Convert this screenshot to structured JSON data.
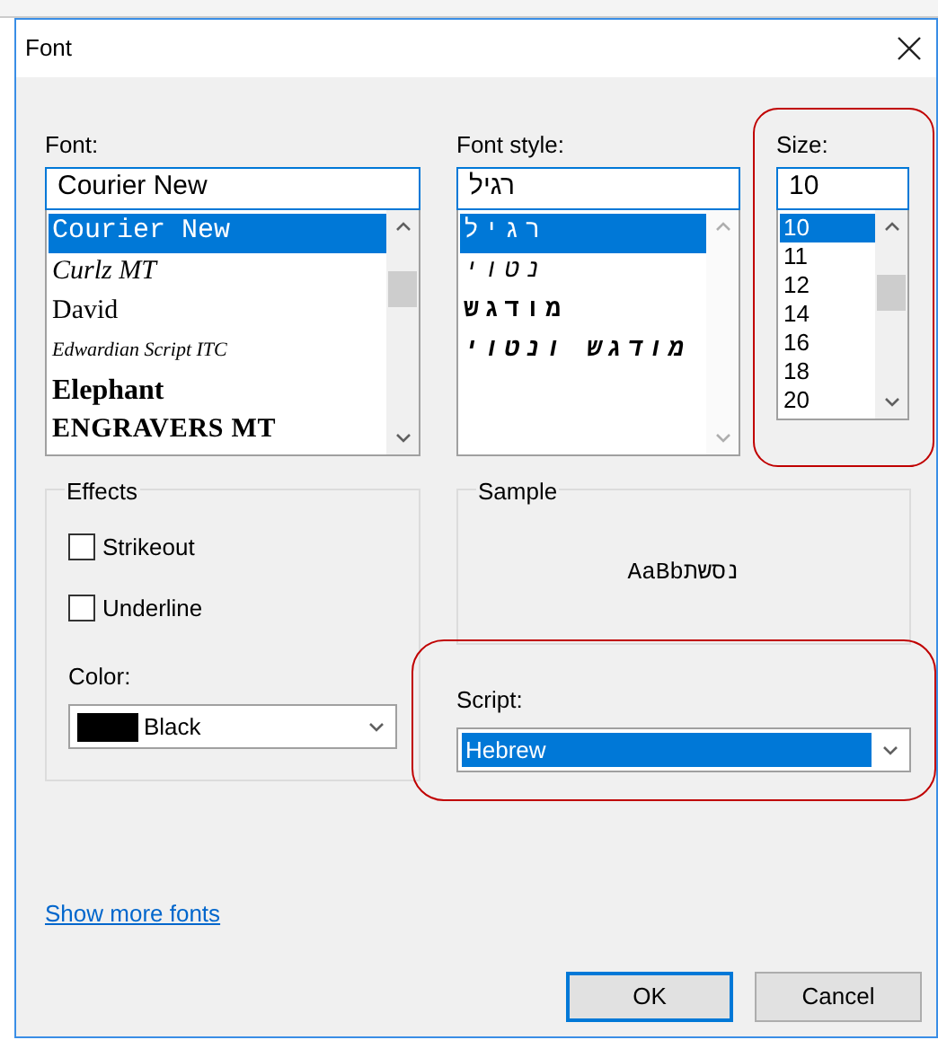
{
  "window": {
    "title": "Font"
  },
  "font": {
    "label": "Font:",
    "value": "Courier New",
    "items": [
      {
        "label": "Courier New",
        "selected": true
      },
      {
        "label": "Curlz MT",
        "selected": false
      },
      {
        "label": "David",
        "selected": false
      },
      {
        "label": "Edwardian Script ITC",
        "selected": false
      },
      {
        "label": "Elephant",
        "selected": false
      },
      {
        "label": "ENGRAVERS MT",
        "selected": false
      }
    ]
  },
  "font_style": {
    "label": "Font style:",
    "value": "רגיל",
    "items": [
      {
        "label": "רגיל",
        "selected": true
      },
      {
        "label": "נטוי",
        "selected": false
      },
      {
        "label": "מודגש",
        "selected": false
      },
      {
        "label": "מודגש ונטוי",
        "selected": false
      }
    ]
  },
  "size": {
    "label": "Size:",
    "value": "10",
    "items": [
      {
        "label": "10",
        "selected": true
      },
      {
        "label": "11",
        "selected": false
      },
      {
        "label": "12",
        "selected": false
      },
      {
        "label": "14",
        "selected": false
      },
      {
        "label": "16",
        "selected": false
      },
      {
        "label": "18",
        "selected": false
      },
      {
        "label": "20",
        "selected": false
      }
    ]
  },
  "effects": {
    "title": "Effects",
    "options": [
      {
        "label": "Strikeout",
        "checked": false
      },
      {
        "label": "Underline",
        "checked": false
      }
    ],
    "color_label": "Color:",
    "color_value": "Black",
    "color": "#000000"
  },
  "sample": {
    "title": "Sample",
    "text": "AaBbנסשת"
  },
  "script": {
    "label": "Script:",
    "value": "Hebrew",
    "highlighted": true
  },
  "link": "Show more fonts",
  "buttons": [
    {
      "label": "OK",
      "default": true
    },
    {
      "label": "Cancel",
      "default": false
    }
  ]
}
